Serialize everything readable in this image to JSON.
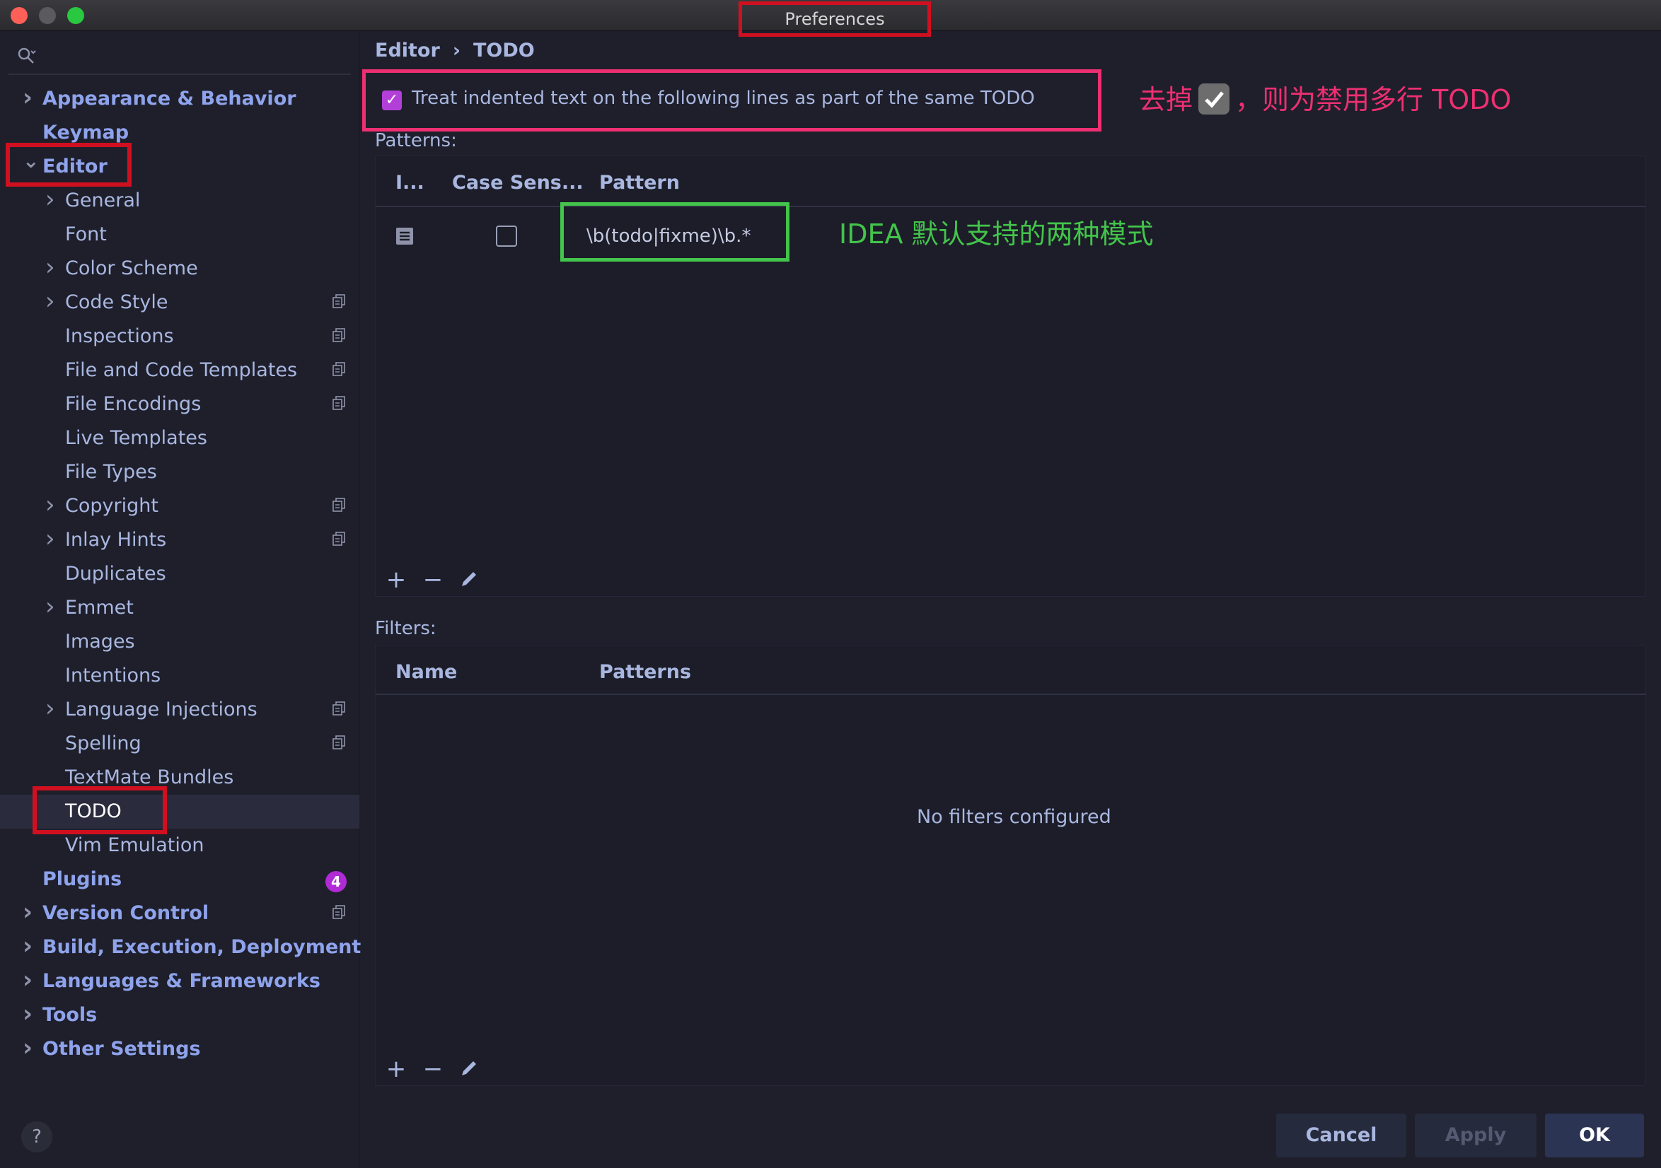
{
  "window": {
    "title": "Preferences"
  },
  "sidebar": {
    "items": [
      {
        "label": "Appearance & Behavior",
        "level": 0,
        "chevron": "right",
        "copy_icon": false
      },
      {
        "label": "Keymap",
        "level": 0,
        "chevron": "none",
        "copy_icon": false
      },
      {
        "label": "Editor",
        "level": 0,
        "chevron": "down",
        "copy_icon": false
      },
      {
        "label": "General",
        "level": 1,
        "chevron": "right",
        "copy_icon": false
      },
      {
        "label": "Font",
        "level": 1,
        "chevron": "none",
        "copy_icon": false
      },
      {
        "label": "Color Scheme",
        "level": 1,
        "chevron": "right",
        "copy_icon": false
      },
      {
        "label": "Code Style",
        "level": 1,
        "chevron": "right",
        "copy_icon": true
      },
      {
        "label": "Inspections",
        "level": 1,
        "chevron": "none",
        "copy_icon": true
      },
      {
        "label": "File and Code Templates",
        "level": 1,
        "chevron": "none",
        "copy_icon": true
      },
      {
        "label": "File Encodings",
        "level": 1,
        "chevron": "none",
        "copy_icon": true
      },
      {
        "label": "Live Templates",
        "level": 1,
        "chevron": "none",
        "copy_icon": false
      },
      {
        "label": "File Types",
        "level": 1,
        "chevron": "none",
        "copy_icon": false
      },
      {
        "label": "Copyright",
        "level": 1,
        "chevron": "right",
        "copy_icon": true
      },
      {
        "label": "Inlay Hints",
        "level": 1,
        "chevron": "right",
        "copy_icon": true
      },
      {
        "label": "Duplicates",
        "level": 1,
        "chevron": "none",
        "copy_icon": false
      },
      {
        "label": "Emmet",
        "level": 1,
        "chevron": "right",
        "copy_icon": false
      },
      {
        "label": "Images",
        "level": 1,
        "chevron": "none",
        "copy_icon": false
      },
      {
        "label": "Intentions",
        "level": 1,
        "chevron": "none",
        "copy_icon": false
      },
      {
        "label": "Language Injections",
        "level": 1,
        "chevron": "right",
        "copy_icon": true
      },
      {
        "label": "Spelling",
        "level": 1,
        "chevron": "none",
        "copy_icon": true
      },
      {
        "label": "TextMate Bundles",
        "level": 1,
        "chevron": "none",
        "copy_icon": false
      },
      {
        "label": "TODO",
        "level": 1,
        "chevron": "none",
        "copy_icon": false,
        "selected": true
      },
      {
        "label": "Vim Emulation",
        "level": 1,
        "chevron": "none",
        "copy_icon": false
      },
      {
        "label": "Plugins",
        "level": 0,
        "chevron": "none",
        "copy_icon": false,
        "badge": "4"
      },
      {
        "label": "Version Control",
        "level": 0,
        "chevron": "right",
        "copy_icon": true
      },
      {
        "label": "Build, Execution, Deployment",
        "level": 0,
        "chevron": "right",
        "copy_icon": false
      },
      {
        "label": "Languages & Frameworks",
        "level": 0,
        "chevron": "right",
        "copy_icon": false
      },
      {
        "label": "Tools",
        "level": 0,
        "chevron": "right",
        "copy_icon": false
      },
      {
        "label": "Other Settings",
        "level": 0,
        "chevron": "right",
        "copy_icon": false
      }
    ],
    "help_label": "?"
  },
  "breadcrumb": {
    "parent": "Editor",
    "separator": "›",
    "current": "TODO"
  },
  "multiline_option": {
    "checked": true,
    "label": "Treat indented text on the following lines as part of the same TODO"
  },
  "annotations": {
    "pink_before": "去掉",
    "pink_after": "，则为禁用多行 TODO",
    "green": "IDEA 默认支持的两种模式"
  },
  "patterns": {
    "label": "Patterns:",
    "columns": [
      "I...",
      "Case Sens...",
      "Pattern"
    ],
    "rows": [
      {
        "icon": "todo-list-icon",
        "case_sensitive": false,
        "pattern": "\\b(todo|fixme)\\b.*"
      }
    ]
  },
  "filters": {
    "label": "Filters:",
    "columns": [
      "Name",
      "Patterns"
    ],
    "empty_text": "No filters configured"
  },
  "toolbar": {
    "add": "+",
    "remove": "−"
  },
  "buttons": {
    "cancel": "Cancel",
    "apply": "Apply",
    "ok": "OK"
  },
  "colors": {
    "accent_pink": "#ee2f72",
    "accent_green": "#43c44b",
    "highlight_red": "#d01020",
    "checkbox_purple": "#b33fd9"
  }
}
